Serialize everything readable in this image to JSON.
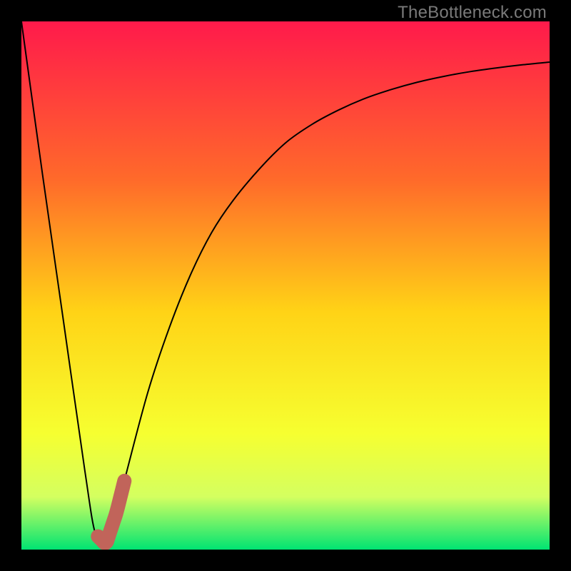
{
  "watermark": {
    "text": "TheBottleneck.com"
  },
  "colors": {
    "black": "#000000",
    "curve": "#000000",
    "marker": "#c1645a",
    "grad_top": "#ff1a4b",
    "grad_mid1": "#ff6a2a",
    "grad_mid2": "#ffd316",
    "grad_mid3": "#f6ff30",
    "grad_mid4": "#d4ff60",
    "grad_bottom": "#00e472"
  },
  "chart_data": {
    "type": "line",
    "title": "",
    "xlabel": "",
    "ylabel": "",
    "xlim": [
      0,
      100
    ],
    "ylim": [
      0,
      100
    ],
    "series": [
      {
        "name": "bottleneck-curve",
        "x": [
          0,
          4,
          8,
          12,
          14,
          16,
          18,
          20,
          24,
          28,
          32,
          36,
          40,
          45,
          50,
          55,
          60,
          65,
          70,
          75,
          80,
          85,
          90,
          95,
          100
        ],
        "y": [
          100,
          71,
          43,
          15,
          3,
          1,
          7,
          15,
          30,
          42,
          52,
          60,
          66,
          72,
          77,
          80.5,
          83.2,
          85.4,
          87.1,
          88.5,
          89.6,
          90.5,
          91.2,
          91.8,
          92.3
        ]
      }
    ],
    "marker": {
      "name": "highlight-J",
      "x_start": 14.5,
      "x_end": 19.5,
      "comment": "Thick salmon J-shaped marker near the curve minimum"
    },
    "gradient_stops": [
      {
        "pos": 0.0,
        "color": "#ff1a4b"
      },
      {
        "pos": 0.3,
        "color": "#ff6a2a"
      },
      {
        "pos": 0.55,
        "color": "#ffd316"
      },
      {
        "pos": 0.78,
        "color": "#f6ff30"
      },
      {
        "pos": 0.9,
        "color": "#d4ff60"
      },
      {
        "pos": 1.0,
        "color": "#00e472"
      }
    ]
  }
}
